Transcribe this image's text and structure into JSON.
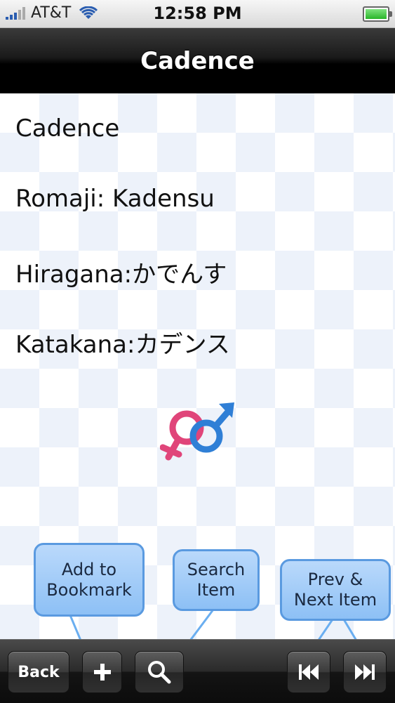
{
  "status_bar": {
    "carrier": "AT&T",
    "time": "12:58 PM",
    "icons": [
      "signal-icon",
      "wifi-icon",
      "battery-icon"
    ]
  },
  "nav": {
    "title": "Cadence"
  },
  "entry": {
    "word": "Cadence",
    "romaji": "Romaji: Kadensu",
    "hiragana": "Hiragana:かでんす",
    "katakana": "Katakana:カデンス",
    "image": "gender-symbols-icon"
  },
  "tooltips": {
    "bookmark": "Add to Bookmark",
    "search": "Search Item",
    "prev_next": "Prev & Next Item"
  },
  "toolbar": {
    "back_label": "Back",
    "add_icon": "plus-icon",
    "search_icon": "magnifier-icon",
    "prev_icon": "skip-back-icon",
    "next_icon": "skip-forward-icon"
  },
  "colors": {
    "tooltip_fill": "#a8cdf8",
    "tooltip_border": "#5a9ae0",
    "venus": "#e0457a",
    "mars": "#2f7fd6"
  }
}
